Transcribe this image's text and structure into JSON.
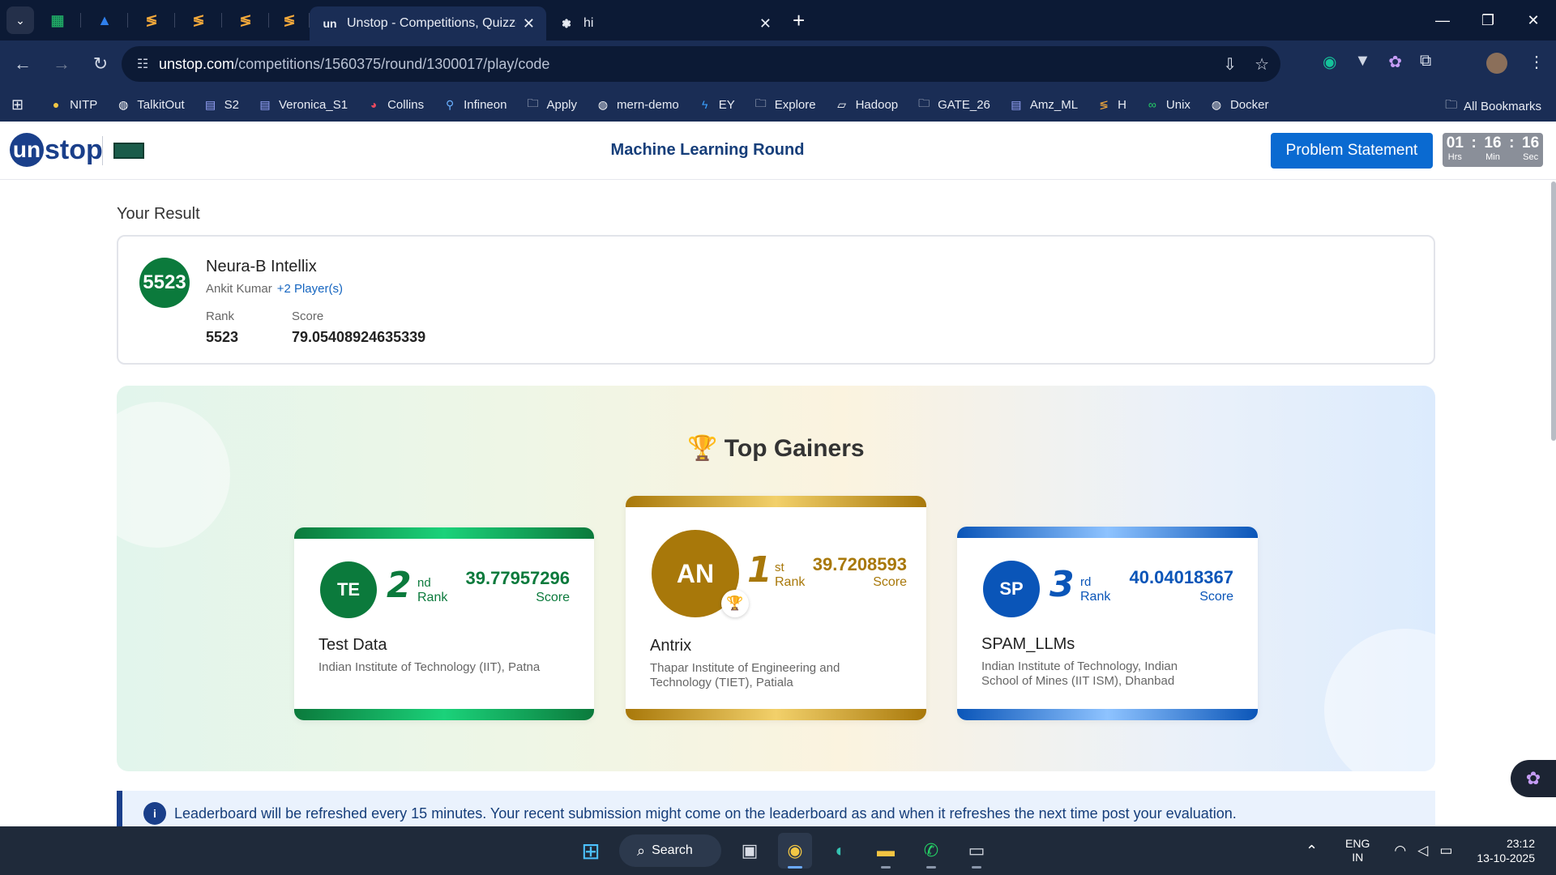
{
  "browser": {
    "tabs": [
      {
        "title": "Unstop - Competitions, Quizzes",
        "favicon": "un",
        "active": true
      },
      {
        "title": "hi",
        "favicon": "openai-icon",
        "active": false
      }
    ],
    "url_host": "unstop.com",
    "url_path": "/competitions/1560375/round/1300017/play/code",
    "bookmarks": [
      {
        "label": "NITP",
        "icon": "circle-logo-icon"
      },
      {
        "label": "TalkitOut",
        "icon": "github-icon"
      },
      {
        "label": "S2",
        "icon": "app-icon"
      },
      {
        "label": "Veronica_S1",
        "icon": "app-icon"
      },
      {
        "label": "Collins",
        "icon": "collins-icon"
      },
      {
        "label": "Infineon",
        "icon": "link-icon"
      },
      {
        "label": "Apply",
        "icon": "folder-icon"
      },
      {
        "label": "mern-demo",
        "icon": "github-icon"
      },
      {
        "label": "EY",
        "icon": "ey-icon"
      },
      {
        "label": "Explore",
        "icon": "folder-icon"
      },
      {
        "label": "Hadoop",
        "icon": "hadoop-icon"
      },
      {
        "label": "GATE_26",
        "icon": "folder-icon"
      },
      {
        "label": "Amz_ML",
        "icon": "app-icon"
      },
      {
        "label": "H",
        "icon": "hackerrank-icon"
      },
      {
        "label": "Unix",
        "icon": "unix-icon"
      },
      {
        "label": "Docker",
        "icon": "github-icon"
      }
    ],
    "all_bookmarks": "All Bookmarks"
  },
  "header": {
    "logo_text": "stop",
    "logo_mark": "un",
    "round_title": "Machine Learning Round",
    "problem_button": "Problem Statement",
    "timer": {
      "hrs": "01",
      "min": "16",
      "sec": "16",
      "hrs_label": "Hrs",
      "min_label": "Min",
      "sec_label": "Sec"
    }
  },
  "result": {
    "heading": "Your Result",
    "rank_badge": "5523",
    "team_name": "Neura-B Intellix",
    "member": "Ankit Kumar",
    "more_players": "+2 Player(s)",
    "rank_label": "Rank",
    "rank_value": "5523",
    "score_label": "Score",
    "score_value": "79.05408924635339"
  },
  "gainers": {
    "title": "Top Gainers",
    "cards": [
      {
        "initials": "TE",
        "rank": "2",
        "suffix": "nd",
        "rank_label": "Rank",
        "score": "39.77957296",
        "score_label": "Score",
        "name": "Test Data",
        "institute": "Indian Institute of Technology (IIT), Patna",
        "color": "#0b7a3c"
      },
      {
        "initials": "AN",
        "rank": "1",
        "suffix": "st",
        "rank_label": "Rank",
        "score": "39.7208593",
        "score_label": "Score",
        "name": "Antrix",
        "institute": "Thapar Institute of Engineering and Technology (TIET), Patiala",
        "color": "#a8780a"
      },
      {
        "initials": "SP",
        "rank": "3",
        "suffix": "rd",
        "rank_label": "Rank",
        "score": "40.04018367",
        "score_label": "Score",
        "name": "SPAM_LLMs",
        "institute": "Indian Institute of Technology, Indian School of Mines (IIT ISM), Dhanbad",
        "color": "#0a55b8"
      }
    ]
  },
  "notice": "Leaderboard will be refreshed every 15 minutes. Your recent submission might come on the leaderboard as and when it refreshes the next time post your evaluation.",
  "taskbar": {
    "search": "Search",
    "lang_top": "ENG",
    "lang_bottom": "IN",
    "time": "23:12",
    "date": "13-10-2025"
  }
}
